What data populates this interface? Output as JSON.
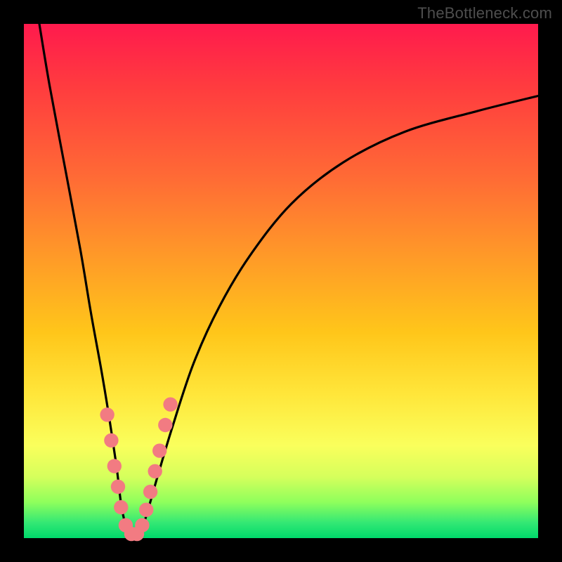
{
  "watermark": "TheBottleneck.com",
  "chart_data": {
    "type": "line",
    "title": "",
    "xlabel": "",
    "ylabel": "",
    "xlim": [
      0,
      100
    ],
    "ylim": [
      0,
      100
    ],
    "grid": false,
    "legend": false,
    "series": [
      {
        "name": "bottleneck-curve",
        "x": [
          3,
          5,
          8,
          11,
          13,
          15,
          16.5,
          18,
          19,
          20,
          21,
          22,
          23,
          24,
          26,
          29,
          33,
          38,
          44,
          52,
          62,
          74,
          88,
          100
        ],
        "y": [
          100,
          88,
          72,
          56,
          44,
          33,
          24,
          14,
          6,
          2,
          0.5,
          0.5,
          2,
          5,
          12,
          22,
          34,
          45,
          55,
          65,
          73,
          79,
          83,
          86
        ]
      }
    ],
    "markers": {
      "name": "highlight-dots",
      "color": "#f27b82",
      "radius_pct": 1.4,
      "points": [
        {
          "x": 16.2,
          "y": 24
        },
        {
          "x": 17.0,
          "y": 19
        },
        {
          "x": 17.6,
          "y": 14
        },
        {
          "x": 18.3,
          "y": 10
        },
        {
          "x": 18.9,
          "y": 6
        },
        {
          "x": 19.8,
          "y": 2.5
        },
        {
          "x": 20.9,
          "y": 0.8
        },
        {
          "x": 22.0,
          "y": 0.8
        },
        {
          "x": 23.0,
          "y": 2.5
        },
        {
          "x": 23.8,
          "y": 5.5
        },
        {
          "x": 24.6,
          "y": 9
        },
        {
          "x": 25.5,
          "y": 13
        },
        {
          "x": 26.4,
          "y": 17
        },
        {
          "x": 27.5,
          "y": 22
        },
        {
          "x": 28.5,
          "y": 26
        }
      ]
    }
  }
}
